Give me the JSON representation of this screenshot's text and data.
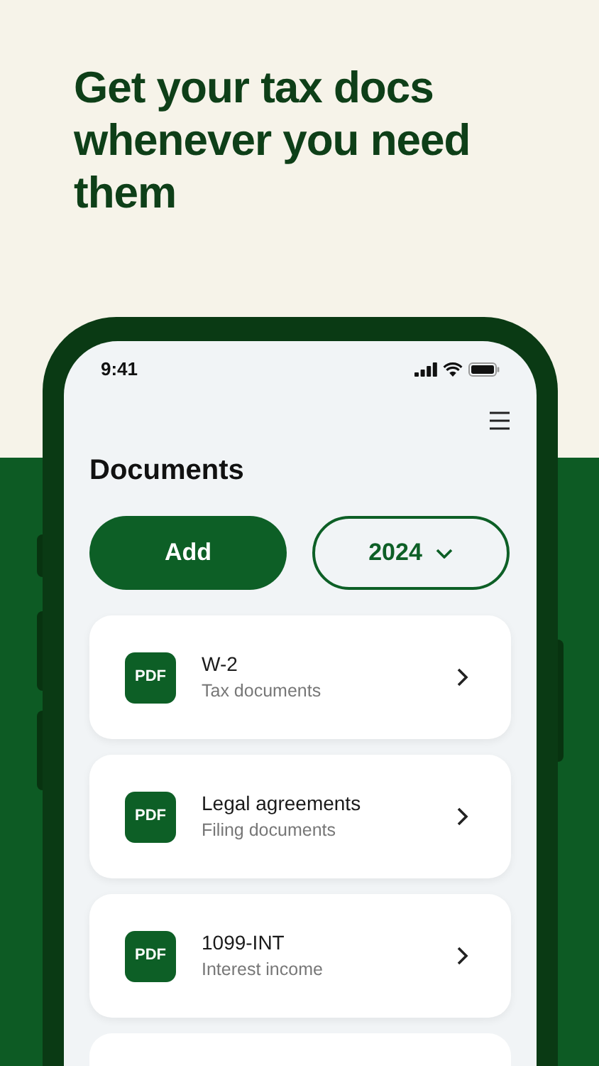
{
  "headline": "Get your tax docs whenever you need them",
  "status_bar": {
    "time": "9:41"
  },
  "page_title": "Documents",
  "add_button": "Add",
  "year_picker": {
    "value": "2024"
  },
  "documents": [
    {
      "badge": "PDF",
      "title": "W-2",
      "subtitle": "Tax documents"
    },
    {
      "badge": "PDF",
      "title": "Legal agreements",
      "subtitle": "Filing documents"
    },
    {
      "badge": "PDF",
      "title": "1099-INT",
      "subtitle": "Interest income"
    }
  ]
}
